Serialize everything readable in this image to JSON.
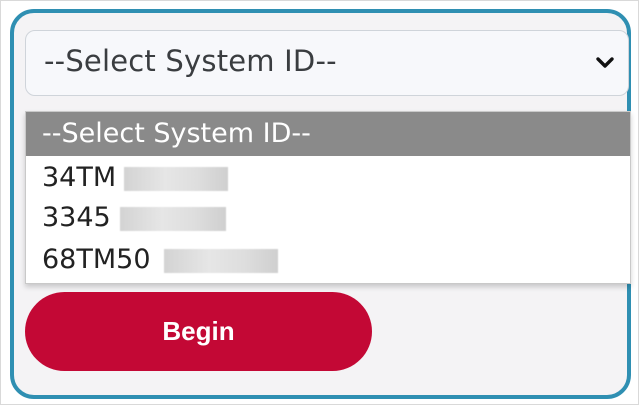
{
  "select": {
    "current_value": "--Select System ID--"
  },
  "dropdown": {
    "options": [
      {
        "label": "--Select System ID--"
      },
      {
        "label": "34TM"
      },
      {
        "label": "3345"
      },
      {
        "label": "68TM50"
      }
    ]
  },
  "actions": {
    "begin_label": "Begin"
  },
  "colors": {
    "card_border": "#2f8fb2",
    "selected_option_bg": "#8a8a8a",
    "begin_button_bg": "#c30835"
  },
  "icons": {
    "select_chevron": "chevron-down-icon"
  }
}
